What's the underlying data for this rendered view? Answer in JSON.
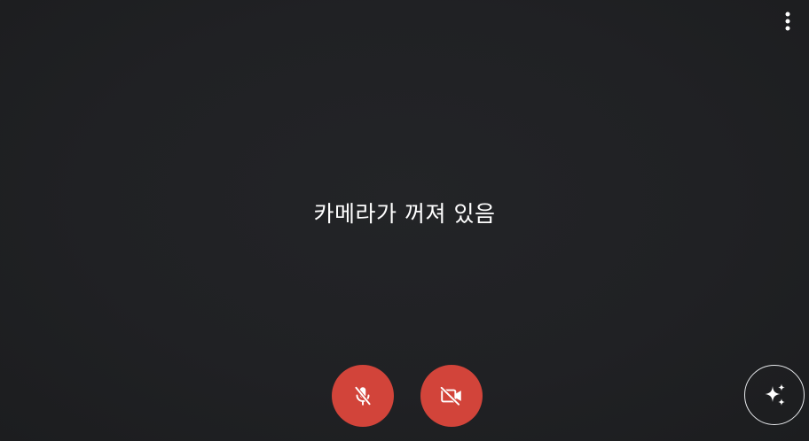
{
  "status": {
    "camera_off_text": "카메라가 꺼져 있음"
  },
  "icons": {
    "more": "more-vert-icon",
    "mic": "mic-off-icon",
    "camera": "videocam-off-icon",
    "effects": "sparkle-icon"
  },
  "colors": {
    "background": "#202124",
    "control_off": "#d2443a",
    "icon": "#ffffff"
  }
}
